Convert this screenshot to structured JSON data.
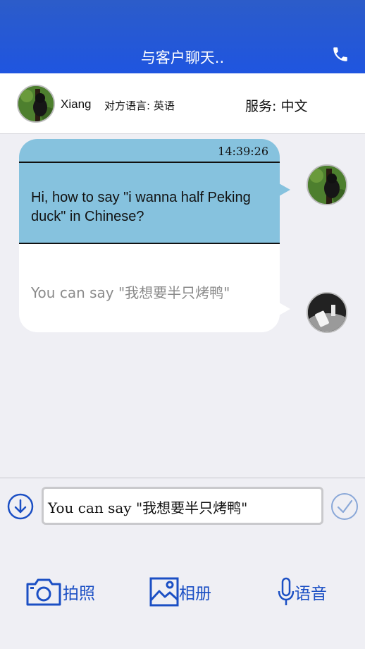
{
  "header": {
    "title": "与客户聊天..",
    "phone_icon": "phone-icon"
  },
  "info_bar": {
    "name": "Xiang",
    "peer_language": "对方语言: 英语",
    "service_language": "服务: 中文"
  },
  "messages": [
    {
      "time": "14:39:26",
      "original": "Hi, how to say \"i wanna half Peking duck\" in Chinese?",
      "translation": "You can say \"我想要半只烤鸭\""
    }
  ],
  "composer": {
    "value": "You can say \"我想要半只烤鸭\"",
    "down_icon": "arrow-down-circle-icon",
    "send_icon": "check-circle-icon"
  },
  "actions": [
    {
      "label": "拍照",
      "icon": "camera-icon"
    },
    {
      "label": "相册",
      "icon": "photo-album-icon"
    },
    {
      "label": "语音",
      "icon": "microphone-icon"
    }
  ],
  "colors": {
    "header": "#1f55e0",
    "bubble_top": "#86c2de",
    "action": "#1b4fc4",
    "background": "#efeff4"
  }
}
